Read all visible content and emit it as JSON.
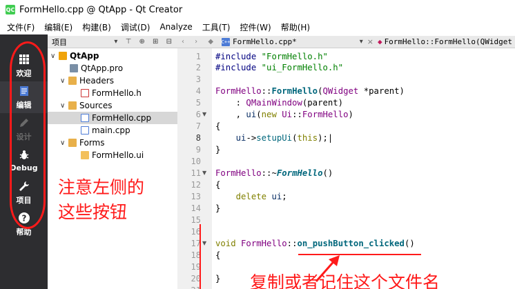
{
  "window": {
    "title": "FormHello.cpp @ QtApp - Qt Creator",
    "app_icon_text": "QC"
  },
  "menu": [
    "文件(F)",
    "编辑(E)",
    "构建(B)",
    "调试(D)",
    "Analyze",
    "工具(T)",
    "控件(W)",
    "帮助(H)"
  ],
  "modes": [
    {
      "label": "欢迎",
      "icon": "grid-icon"
    },
    {
      "label": "编辑",
      "icon": "document-icon"
    },
    {
      "label": "设计",
      "icon": "pencil-icon"
    },
    {
      "label": "Debug",
      "icon": "bug-icon"
    },
    {
      "label": "项目",
      "icon": "wrench-icon"
    },
    {
      "label": "帮助",
      "icon": "help-icon"
    }
  ],
  "project_pane": {
    "header": "项目",
    "tree": [
      {
        "label": "QtApp"
      },
      {
        "label": "QtApp.pro"
      },
      {
        "label": "Headers"
      },
      {
        "label": "FormHello.h"
      },
      {
        "label": "Sources"
      },
      {
        "label": "FormHello.cpp"
      },
      {
        "label": "main.cpp"
      },
      {
        "label": "Forms"
      },
      {
        "label": "FormHello.ui"
      }
    ]
  },
  "editor": {
    "tab_file": "FormHello.cpp*",
    "tab_symbol": "FormHello::FormHello(QWidget",
    "line_numbers": [
      "1",
      "2",
      "3",
      "4",
      "5",
      "6",
      "7",
      "8",
      "9",
      "10",
      "11",
      "12",
      "13",
      "14",
      "15",
      "16",
      "17",
      "18",
      "19",
      "20",
      "21"
    ]
  },
  "annotations": {
    "left_note_line1": "注意左侧的",
    "left_note_line2": "这些按钮",
    "bottom_note": "复制或者记住这个文件名"
  },
  "colors": {
    "annotation": "#ff1a1a",
    "modebar": "#2d2d30",
    "selected_row": "#d7d7d7"
  }
}
